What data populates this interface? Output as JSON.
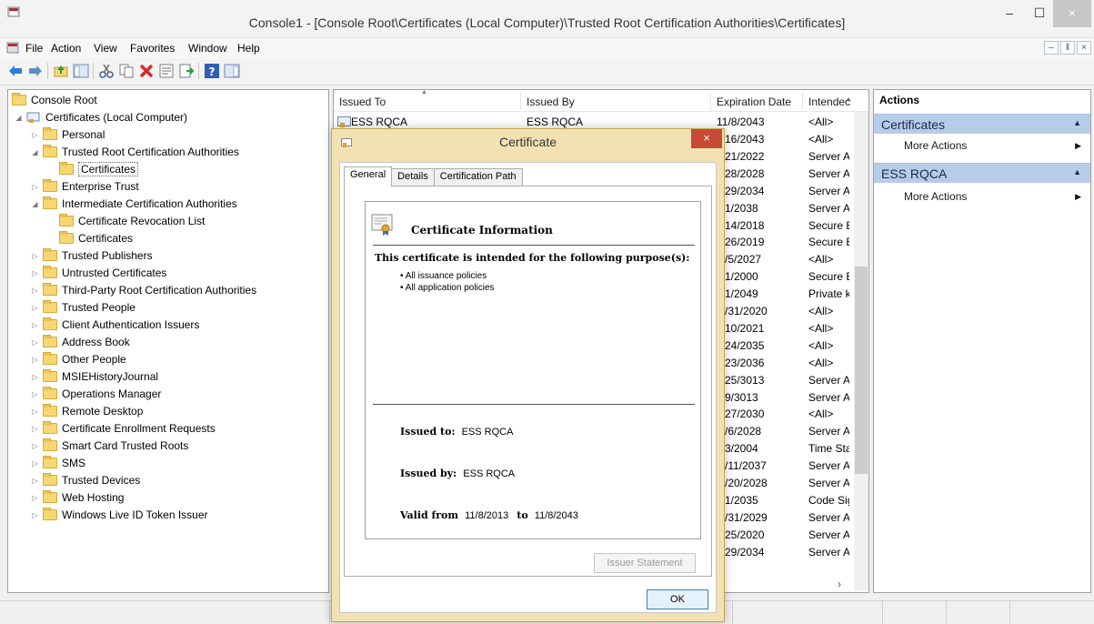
{
  "window": {
    "title": "Console1 - [Console Root\\Certificates (Local Computer)\\Trusted Root Certification Authorities\\Certificates]",
    "min_glyph": "–",
    "max_glyph": "☐",
    "close_glyph": "×"
  },
  "menu": [
    "File",
    "Action",
    "View",
    "Favorites",
    "Window",
    "Help"
  ],
  "mdi_controls": [
    "–",
    "ǁ",
    "×"
  ],
  "tree": {
    "root": "Console Root",
    "items": [
      {
        "label": "Certificates (Local Computer)",
        "indent": 1,
        "expander": "◢",
        "icon": "certificate-store-icon"
      },
      {
        "label": "Personal",
        "indent": 2,
        "expander": "▷",
        "icon": "folder-icon"
      },
      {
        "label": "Trusted Root Certification Authorities",
        "indent": 2,
        "expander": "◢",
        "icon": "folder-icon"
      },
      {
        "label": "Certificates",
        "indent": 3,
        "expander": "",
        "icon": "folder-icon",
        "selected": true
      },
      {
        "label": "Enterprise Trust",
        "indent": 2,
        "expander": "▷",
        "icon": "folder-icon"
      },
      {
        "label": "Intermediate Certification Authorities",
        "indent": 2,
        "expander": "◢",
        "icon": "folder-icon"
      },
      {
        "label": "Certificate Revocation List",
        "indent": 3,
        "expander": "",
        "icon": "folder-icon"
      },
      {
        "label": "Certificates",
        "indent": 3,
        "expander": "",
        "icon": "folder-icon"
      },
      {
        "label": "Trusted Publishers",
        "indent": 2,
        "expander": "▷",
        "icon": "folder-icon"
      },
      {
        "label": "Untrusted Certificates",
        "indent": 2,
        "expander": "▷",
        "icon": "folder-icon"
      },
      {
        "label": "Third-Party Root Certification Authorities",
        "indent": 2,
        "expander": "▷",
        "icon": "folder-icon"
      },
      {
        "label": "Trusted People",
        "indent": 2,
        "expander": "▷",
        "icon": "folder-icon"
      },
      {
        "label": "Client Authentication Issuers",
        "indent": 2,
        "expander": "▷",
        "icon": "folder-icon"
      },
      {
        "label": "Address Book",
        "indent": 2,
        "expander": "▷",
        "icon": "folder-icon"
      },
      {
        "label": "Other People",
        "indent": 2,
        "expander": "▷",
        "icon": "folder-icon"
      },
      {
        "label": "MSIEHistoryJournal",
        "indent": 2,
        "expander": "▷",
        "icon": "folder-icon"
      },
      {
        "label": "Operations Manager",
        "indent": 2,
        "expander": "▷",
        "icon": "folder-icon"
      },
      {
        "label": "Remote Desktop",
        "indent": 2,
        "expander": "▷",
        "icon": "folder-icon"
      },
      {
        "label": "Certificate Enrollment Requests",
        "indent": 2,
        "expander": "▷",
        "icon": "folder-icon"
      },
      {
        "label": "Smart Card Trusted Roots",
        "indent": 2,
        "expander": "▷",
        "icon": "folder-icon"
      },
      {
        "label": "SMS",
        "indent": 2,
        "expander": "▷",
        "icon": "folder-icon"
      },
      {
        "label": "Trusted Devices",
        "indent": 2,
        "expander": "▷",
        "icon": "folder-icon"
      },
      {
        "label": "Web Hosting",
        "indent": 2,
        "expander": "▷",
        "icon": "folder-icon"
      },
      {
        "label": "Windows Live ID Token Issuer",
        "indent": 2,
        "expander": "▷",
        "icon": "folder-icon"
      }
    ]
  },
  "list": {
    "columns": [
      "Issued To",
      "Issued By",
      "Expiration Date",
      "Intendec"
    ],
    "first_row": {
      "issued_to": "ESS RQCA",
      "issued_by": "ESS RQCA",
      "expiration": "11/8/2043",
      "intended": "<All>"
    },
    "rows": [
      {
        "expiration": "16/2043",
        "intended": "<All>"
      },
      {
        "expiration": "21/2022",
        "intended": "Server A"
      },
      {
        "expiration": "28/2028",
        "intended": "Server A"
      },
      {
        "expiration": "29/2034",
        "intended": "Server A"
      },
      {
        "expiration": "1/2038",
        "intended": "Server A"
      },
      {
        "expiration": "14/2018",
        "intended": "Secure E"
      },
      {
        "expiration": "26/2019",
        "intended": "Secure E"
      },
      {
        "expiration": "/5/2027",
        "intended": "<All>"
      },
      {
        "expiration": "1/2000",
        "intended": "Secure E"
      },
      {
        "expiration": "1/2049",
        "intended": "Private k"
      },
      {
        "expiration": "/31/2020",
        "intended": "<All>"
      },
      {
        "expiration": "10/2021",
        "intended": "<All>"
      },
      {
        "expiration": "24/2035",
        "intended": "<All>"
      },
      {
        "expiration": "23/2036",
        "intended": "<All>"
      },
      {
        "expiration": "25/3013",
        "intended": "Server A"
      },
      {
        "expiration": "9/3013",
        "intended": "Server A"
      },
      {
        "expiration": "27/2030",
        "intended": "<All>"
      },
      {
        "expiration": "/6/2028",
        "intended": "Server A"
      },
      {
        "expiration": "3/2004",
        "intended": "Time Sta"
      },
      {
        "expiration": "/11/2037",
        "intended": "Server A"
      },
      {
        "expiration": "/20/2028",
        "intended": "Server A"
      },
      {
        "expiration": "1/2035",
        "intended": "Code Sig"
      },
      {
        "expiration": "/31/2029",
        "intended": "Server A"
      },
      {
        "expiration": "25/2020",
        "intended": "Server A"
      },
      {
        "expiration": "29/2034",
        "intended": "Server A"
      }
    ],
    "h_scroll_right": "›"
  },
  "actions": {
    "title": "Actions",
    "sections": [
      {
        "label": "Certificates",
        "link": "More Actions"
      },
      {
        "label": "ESS RQCA",
        "link": "More Actions"
      }
    ]
  },
  "dialog": {
    "title": "Certificate",
    "close_glyph": "×",
    "tabs": [
      "General",
      "Details",
      "Certification Path"
    ],
    "info_title": "Certificate Information",
    "purpose_heading": "This certificate is intended for the following purpose(s):",
    "purposes": [
      "• All issuance policies",
      "• All application policies"
    ],
    "issued_to_label": "Issued to:",
    "issued_to_value": "ESS RQCA",
    "issued_by_label": "Issued by:",
    "issued_by_value": "ESS RQCA",
    "valid_from_label": "Valid from",
    "valid_from_value": "11/8/2013",
    "valid_to_label": "to",
    "valid_to_value": "11/8/2043",
    "issuer_statement_label": "Issuer Statement",
    "ok_label": "OK"
  },
  "colors": {
    "accent_blue": "#b7cde7",
    "dialog_frame": "#f2e2b3",
    "dialog_close": "#c74a35"
  }
}
